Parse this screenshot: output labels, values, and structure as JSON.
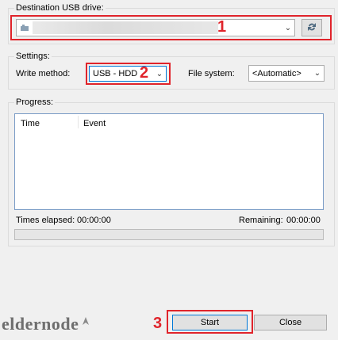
{
  "destination": {
    "legend": "Destination USB drive:",
    "drive_value": "",
    "annotation": "1"
  },
  "settings": {
    "legend": "Settings:",
    "write_method_label": "Write method:",
    "write_method_value": "USB - HDD",
    "write_method_annotation": "2",
    "file_system_label": "File system:",
    "file_system_value": "<Automatic>"
  },
  "progress": {
    "legend": "Progress:",
    "columns": [
      "Time",
      "Event"
    ],
    "times_elapsed_label": "Times elapsed:",
    "times_elapsed_value": "00:00:00",
    "remaining_label": "Remaining:",
    "remaining_value": "00:00:00",
    "percent": 0
  },
  "footer": {
    "logo_text": "eldernode",
    "start_annotation": "3",
    "start_label": "Start",
    "close_label": "Close"
  },
  "colors": {
    "annotation_red": "#e0242b",
    "focus_blue": "#0078d7"
  }
}
